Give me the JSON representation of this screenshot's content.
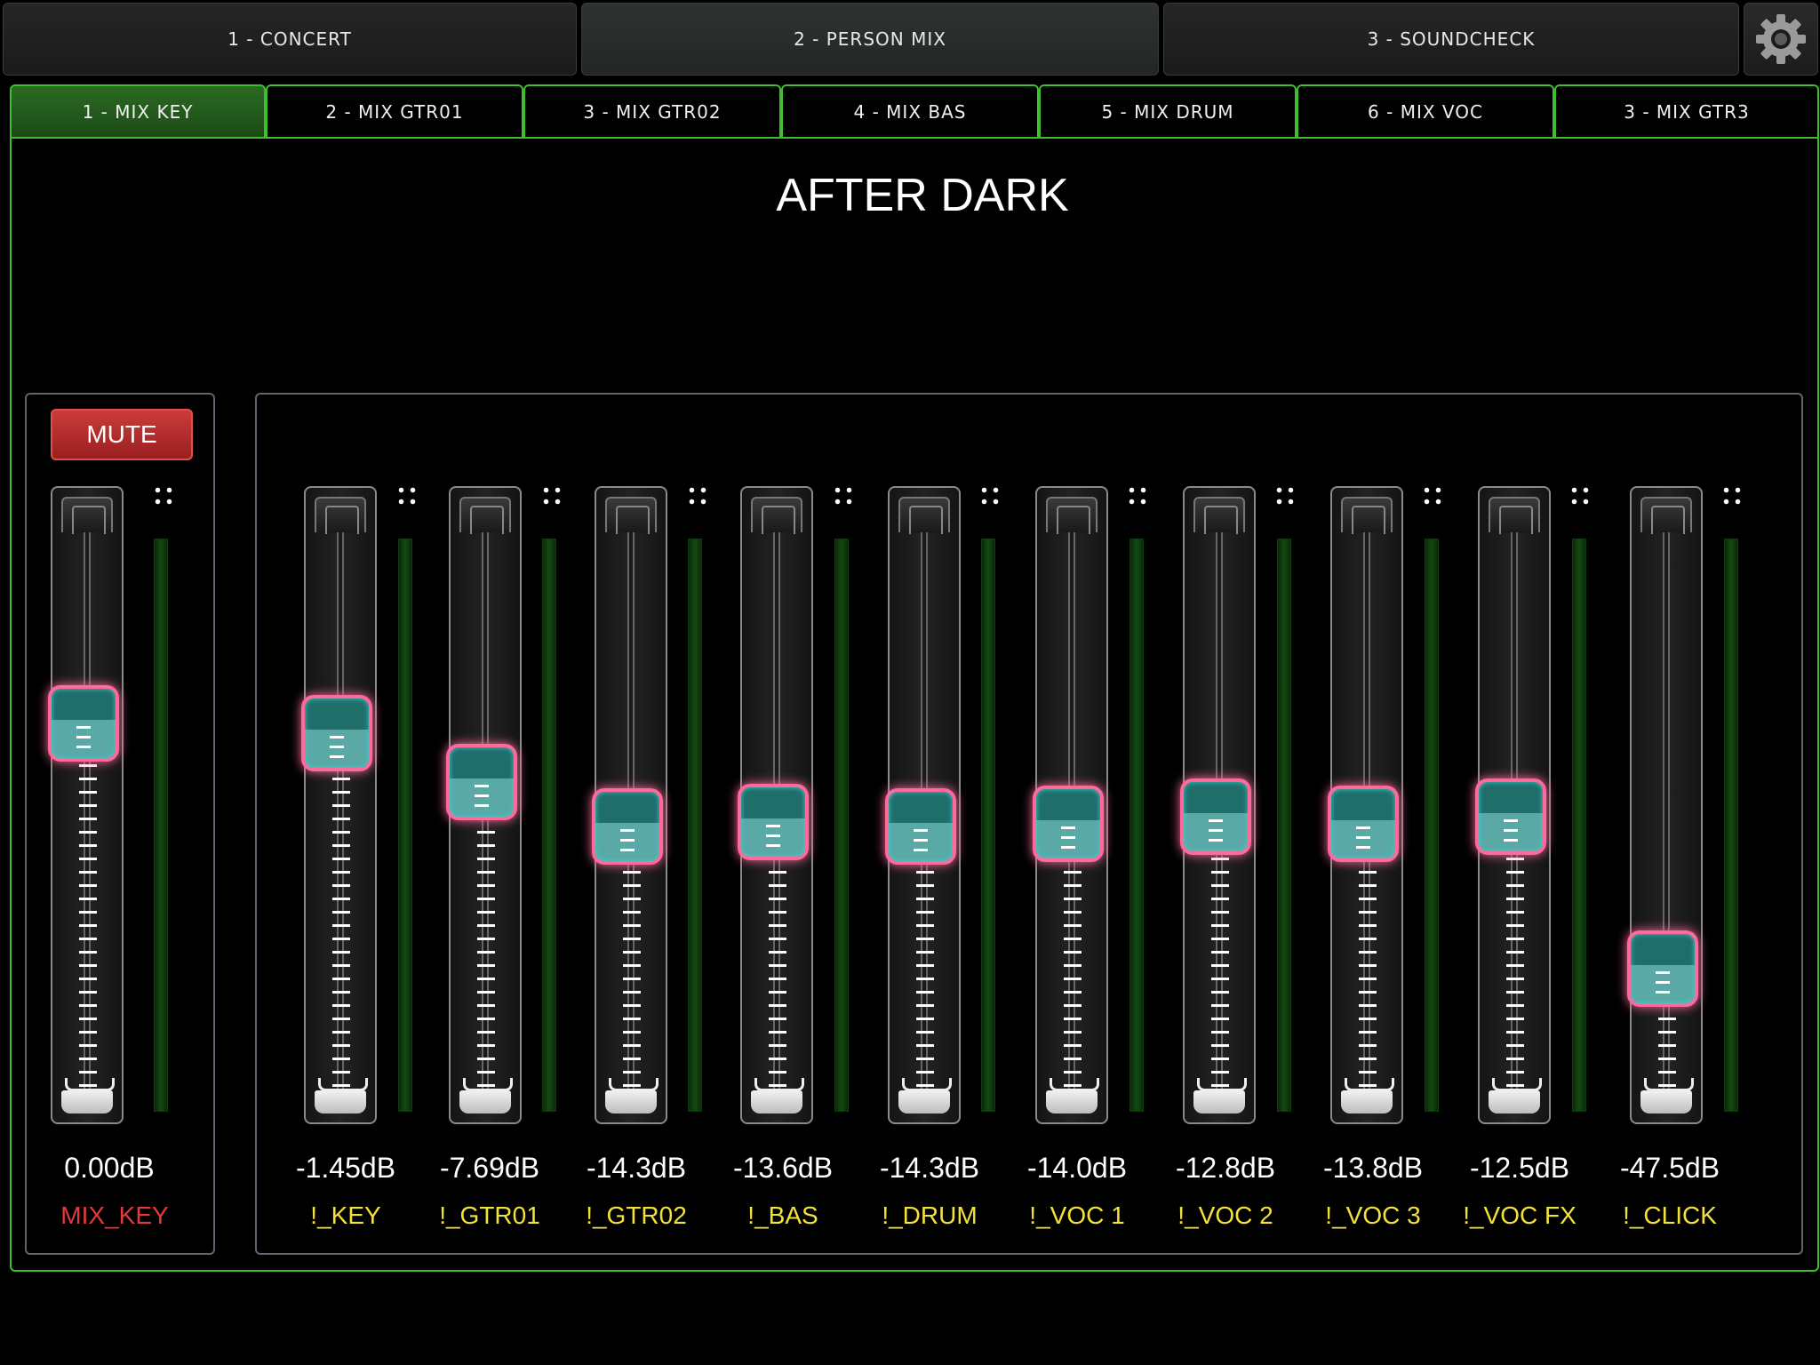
{
  "scenes": [
    {
      "label": "1 - CONCERT",
      "active": false
    },
    {
      "label": "2 - PERSON MIX",
      "active": true
    },
    {
      "label": "3 - SOUNDCHECK",
      "active": false
    }
  ],
  "settings_icon": "gear-icon",
  "tabs": [
    {
      "label": "1 - MIX KEY",
      "active": true
    },
    {
      "label": "2 -  MIX GTR01",
      "active": false
    },
    {
      "label": "3 - MIX GTR02",
      "active": false
    },
    {
      "label": "4 - MIX BAS",
      "active": false
    },
    {
      "label": "5 - MIX DRUM",
      "active": false
    },
    {
      "label": "6 - MIX VOC",
      "active": false
    },
    {
      "label": "3 - MIX GTR3",
      "active": false
    }
  ],
  "song_title": "AFTER DARK",
  "master": {
    "mute_label": "MUTE",
    "level": "0.00dB",
    "name": "MIX_KEY",
    "fader_position": 0.67
  },
  "channels": [
    {
      "level": "-1.45dB",
      "name": "!_KEY",
      "fader_position": 0.65
    },
    {
      "level": "-7.69dB",
      "name": "!_GTR01",
      "fader_position": 0.55
    },
    {
      "level": "-14.3dB",
      "name": "!_GTR02",
      "fader_position": 0.46
    },
    {
      "level": "-13.6dB",
      "name": "!_BAS",
      "fader_position": 0.47
    },
    {
      "level": "-14.3dB",
      "name": "!_DRUM",
      "fader_position": 0.46
    },
    {
      "level": "-14.0dB",
      "name": "!_VOC 1",
      "fader_position": 0.465
    },
    {
      "level": "-12.8dB",
      "name": "!_VOC 2",
      "fader_position": 0.48
    },
    {
      "level": "-13.8dB",
      "name": "!_VOC 3",
      "fader_position": 0.465
    },
    {
      "level": "-12.5dB",
      "name": "!_VOC FX",
      "fader_position": 0.48
    },
    {
      "level": "-47.5dB",
      "name": "!_CLICK",
      "fader_position": 0.17
    }
  ],
  "colors": {
    "accent_green": "#3fbf2f",
    "mute_red": "#cc3b3b",
    "channel_name_yellow": "#f2e23a",
    "master_name_red": "#e23a3a",
    "knob_border_pink": "#ff6a9c",
    "knob_teal": "#1f6e6a"
  }
}
